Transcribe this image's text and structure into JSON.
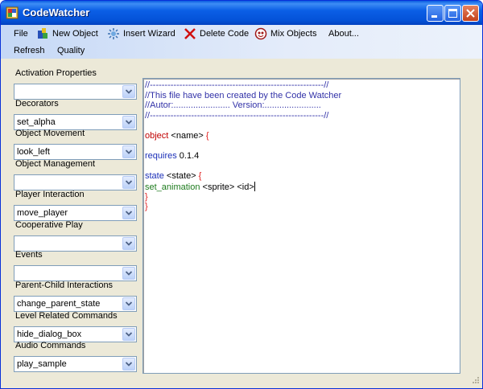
{
  "window": {
    "title": "CodeWatcher"
  },
  "menu": {
    "row1": [
      {
        "id": "file",
        "label": "File",
        "icon": ""
      },
      {
        "id": "new-object",
        "label": "New Object",
        "icon": "new-object-icon"
      },
      {
        "id": "insert-wizard",
        "label": "Insert Wizard",
        "icon": "wizard-icon"
      },
      {
        "id": "delete-code",
        "label": "Delete Code",
        "icon": "delete-x-icon"
      },
      {
        "id": "mix-objects",
        "label": "Mix Objects",
        "icon": "mix-objects-icon"
      },
      {
        "id": "about",
        "label": "About...",
        "icon": ""
      }
    ],
    "row2": [
      {
        "id": "refresh",
        "label": "Refresh"
      },
      {
        "id": "quality",
        "label": "Quality"
      }
    ]
  },
  "panel": {
    "groups": [
      {
        "label": "Activation Properties",
        "value": ""
      },
      {
        "label": "Decorators",
        "value": "set_alpha"
      },
      {
        "label": "Object Movement",
        "value": "look_left"
      },
      {
        "label": "Object Management",
        "value": ""
      },
      {
        "label": "Player Interaction",
        "value": "move_player"
      },
      {
        "label": "Cooperative Play",
        "value": ""
      },
      {
        "label": "Events",
        "value": ""
      },
      {
        "label": "Parent-Child Interactions",
        "value": "change_parent_state"
      },
      {
        "label": "Level Related Commands",
        "value": "hide_dialog_box"
      },
      {
        "label": "Audio Commands",
        "value": "play_sample"
      }
    ]
  },
  "editor": {
    "lines": [
      [
        {
          "t": "//-----------------------------------------------------------//",
          "c": "comment"
        }
      ],
      [
        {
          "t": "//This file have been created by the Code Watcher",
          "c": "comment"
        }
      ],
      [
        {
          "t": "//Autor:....................... Version:.......................",
          "c": "comment"
        }
      ],
      [
        {
          "t": "//-----------------------------------------------------------//",
          "c": "comment"
        }
      ],
      [],
      [
        {
          "t": "object",
          "c": "kw"
        },
        {
          "t": " <name> ",
          "c": "black"
        },
        {
          "t": "{",
          "c": "red"
        }
      ],
      [],
      [
        {
          "t": "requires",
          "c": "blue"
        },
        {
          "t": " 0.1.4",
          "c": "black"
        }
      ],
      [],
      [
        {
          "t": "state",
          "c": "blue"
        },
        {
          "t": " <state> ",
          "c": "black"
        },
        {
          "t": "{",
          "c": "red"
        }
      ],
      [
        {
          "t": "set_animation",
          "c": "green"
        },
        {
          "t": " <sprite> <id>",
          "c": "black"
        }
      ],
      [
        {
          "t": "}",
          "c": "red"
        }
      ],
      [
        {
          "t": "}",
          "c": "red"
        }
      ]
    ]
  },
  "colors": {
    "titlebar": "#0453d8",
    "menubar": "#c5d8f6",
    "window_bg": "#ece9d8",
    "comment": "#3232a8",
    "keyword": "#c00000",
    "blue_keyword": "#1b2fb8",
    "green_command": "#1d7b1d",
    "brace": "#e11e1e"
  }
}
